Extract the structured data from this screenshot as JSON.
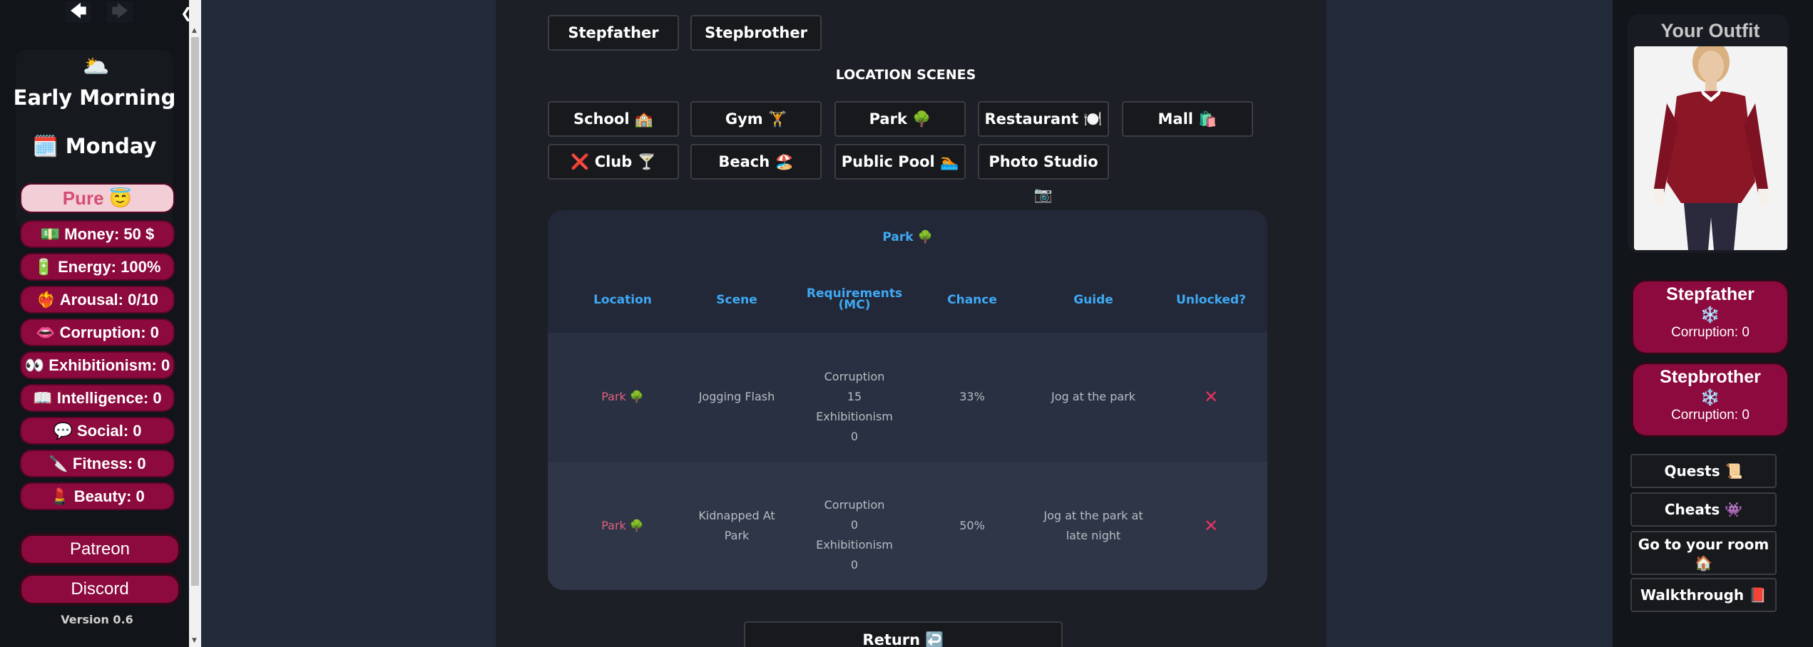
{
  "sidebar": {
    "back_arrow": "🡄",
    "forward_arrow": "🡆",
    "collapse": "❮",
    "weather_icon": "🌥️",
    "time_of_day": "Early Morning",
    "day": "🗓️ Monday",
    "purity": "Pure 😇",
    "stats": [
      "💵 Money: 50 $",
      "🔋 Energy: 100%",
      "❤️‍🔥 Arousal: 0/10",
      "👄 Corruption: 0",
      "👀 Exhibitionism: 0",
      "📖 Intelligence: 0",
      "💬 Social: 0",
      "🔪 Fitness: 0",
      "💄 Beauty: 0"
    ],
    "links": [
      "Patreon",
      "Discord"
    ],
    "version": "Version 0.6"
  },
  "main": {
    "family_buttons": [
      "Stepfather",
      "Stepbrother"
    ],
    "location_scenes_title": "LOCATION SCENES",
    "location_buttons": [
      "School 🏫",
      "Gym 🏋️",
      "Park 🌳",
      "Restaurant 🍽️",
      "Mall 🛍️",
      "❌ Club 🍸",
      "Beach 🏖️",
      "Public Pool 🏊",
      "Photo Studio 📷"
    ],
    "table": {
      "caption": "Park 🌳",
      "headers": [
        "Location",
        "Scene",
        "Requirements (MC)",
        "Chance",
        "Guide",
        "Unlocked?"
      ],
      "rows": [
        {
          "location": "Park 🌳",
          "scene": "Jogging Flash",
          "req_corruption_label": "Corruption",
          "req_corruption": "15",
          "req_exhibitionism_label": "Exhibitionism",
          "req_exhibitionism": "0",
          "chance": "33%",
          "guide": "Jog at the park",
          "unlocked": "✕"
        },
        {
          "location": "Park 🌳",
          "scene": "Kidnapped At Park",
          "req_corruption_label": "Corruption",
          "req_corruption": "0",
          "req_exhibitionism_label": "Exhibitionism",
          "req_exhibitionism": "0",
          "chance": "50%",
          "guide": "Jog at the park at late night",
          "unlocked": "✕"
        }
      ]
    },
    "return_label": "Return ↩️"
  },
  "right": {
    "outfit_title": "Your Outfit",
    "npcs": [
      {
        "name": "Stepfather",
        "icon": "❄️",
        "corruption": "Corruption: 0"
      },
      {
        "name": "Stepbrother",
        "icon": "❄️",
        "corruption": "Corruption: 0"
      }
    ],
    "buttons": [
      "Quests 📜",
      "Cheats 👾",
      "Go to your room 🏠",
      "Walkthrough 📕"
    ]
  }
}
